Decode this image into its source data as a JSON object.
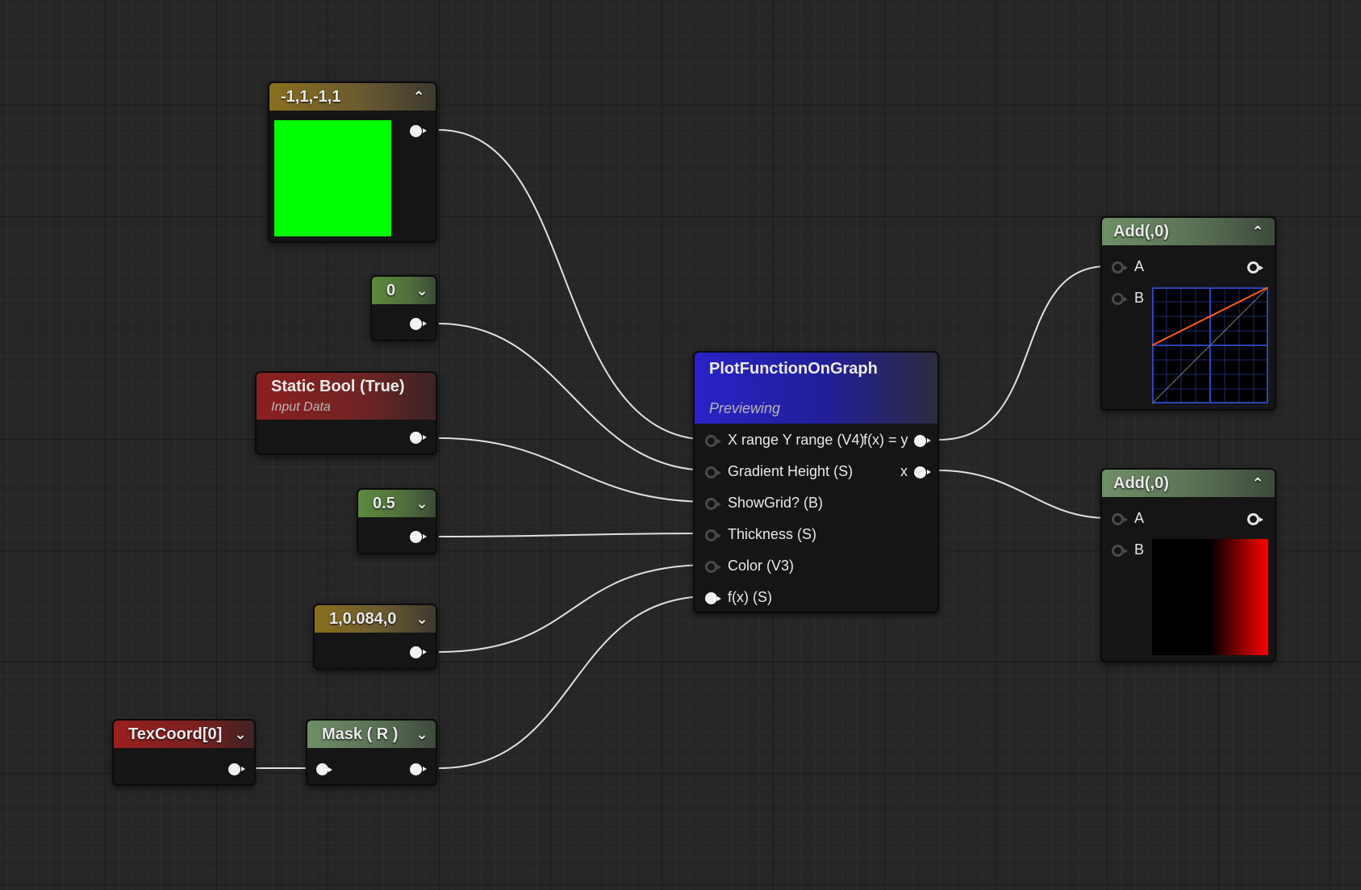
{
  "nodes": {
    "constant4": {
      "title": "-1,1,-1,1",
      "preview_color": "#00ff00"
    },
    "gradient_height": {
      "title": "0"
    },
    "static_bool": {
      "title": "Static Bool (True)",
      "subtitle": "Input Data"
    },
    "thickness": {
      "title": "0.5"
    },
    "color": {
      "title": "1,0.084,0"
    },
    "texcoord": {
      "title": "TexCoord[0]"
    },
    "mask": {
      "title": "Mask ( R )"
    },
    "plot": {
      "title": "PlotFunctionOnGraph",
      "subtitle": "Previewing",
      "inputs": [
        "X range Y range (V4)",
        "Gradient Height (S)",
        "ShowGrid? (B)",
        "Thickness (S)",
        "Color (V3)",
        "f(x) (S)"
      ],
      "outputs": [
        "f(x) = y",
        "x"
      ]
    },
    "add_top": {
      "title": "Add(,0)",
      "pin_a": "A",
      "pin_b": "B",
      "preview": "graph"
    },
    "add_bottom": {
      "title": "Add(,0)",
      "pin_a": "A",
      "pin_b": "B",
      "preview": "gradient"
    }
  },
  "colors": {
    "wire": "#e0e0e0",
    "graph_line": "#ff5a14",
    "graph_grid": "#1b2a6e",
    "gradient_end": "#ff0000"
  },
  "icons": [
    "chevron-up-icon",
    "chevron-down-icon",
    "pin-output-icon",
    "pin-input-icon"
  ]
}
